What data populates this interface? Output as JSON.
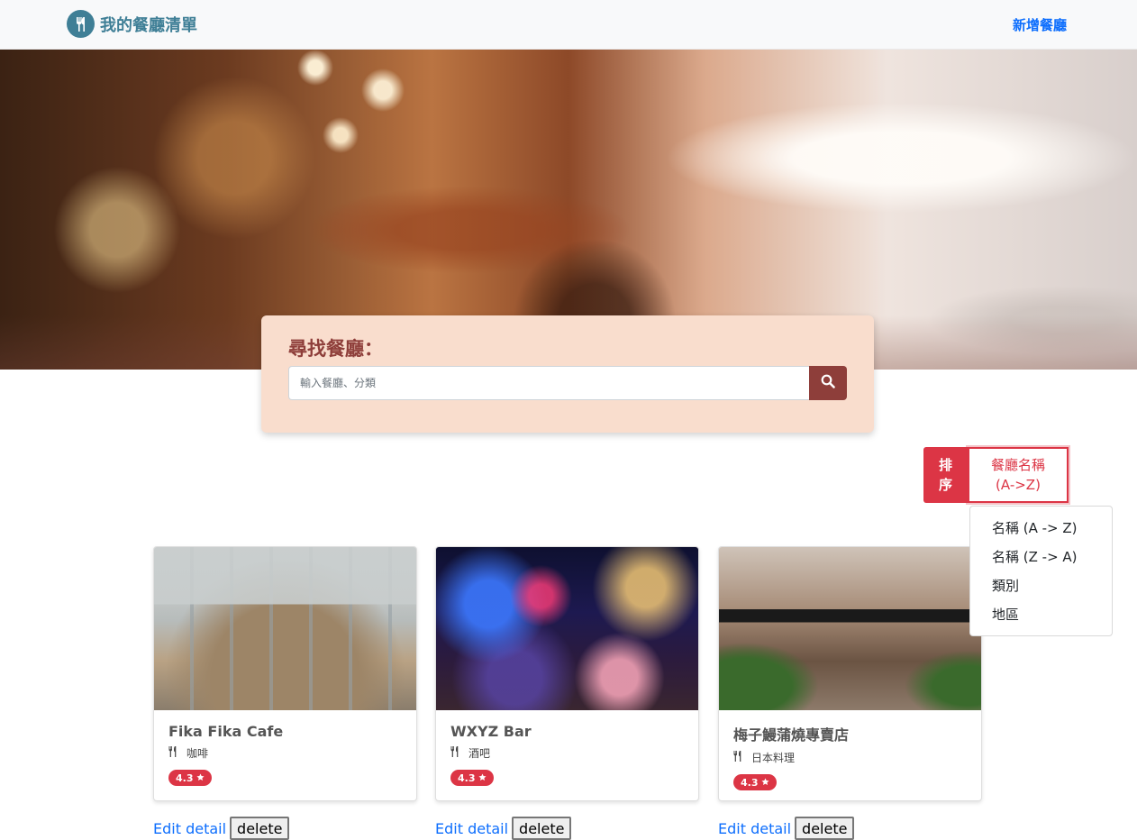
{
  "navbar": {
    "brand": "我的餐廳清單",
    "add_link": "新增餐廳"
  },
  "search": {
    "title": "尋找餐廳：",
    "placeholder": "輸入餐廳、分類"
  },
  "sort": {
    "label_line1": "排",
    "label_line2": "序",
    "selected_line1": "餐廳名稱",
    "selected_line2": "(A->Z)",
    "options": [
      "名稱 (A -> Z)",
      "名稱 (Z -> A)",
      "類別",
      "地區"
    ]
  },
  "restaurants": [
    {
      "name": "Fika Fika Cafe",
      "category": "咖啡",
      "rating": "4.3"
    },
    {
      "name": "WXYZ Bar",
      "category": "酒吧",
      "rating": "4.3"
    },
    {
      "name": "梅子鰻蒲燒專賣店",
      "category": "日本料理",
      "rating": "4.3"
    }
  ],
  "actions": {
    "edit_label": "Edit detail",
    "delete_label": "delete"
  },
  "colors": {
    "brand": "#3f7f96",
    "accent": "#dc3545",
    "search_bg": "#f9ddcd",
    "search_button": "#8e3e3a"
  }
}
